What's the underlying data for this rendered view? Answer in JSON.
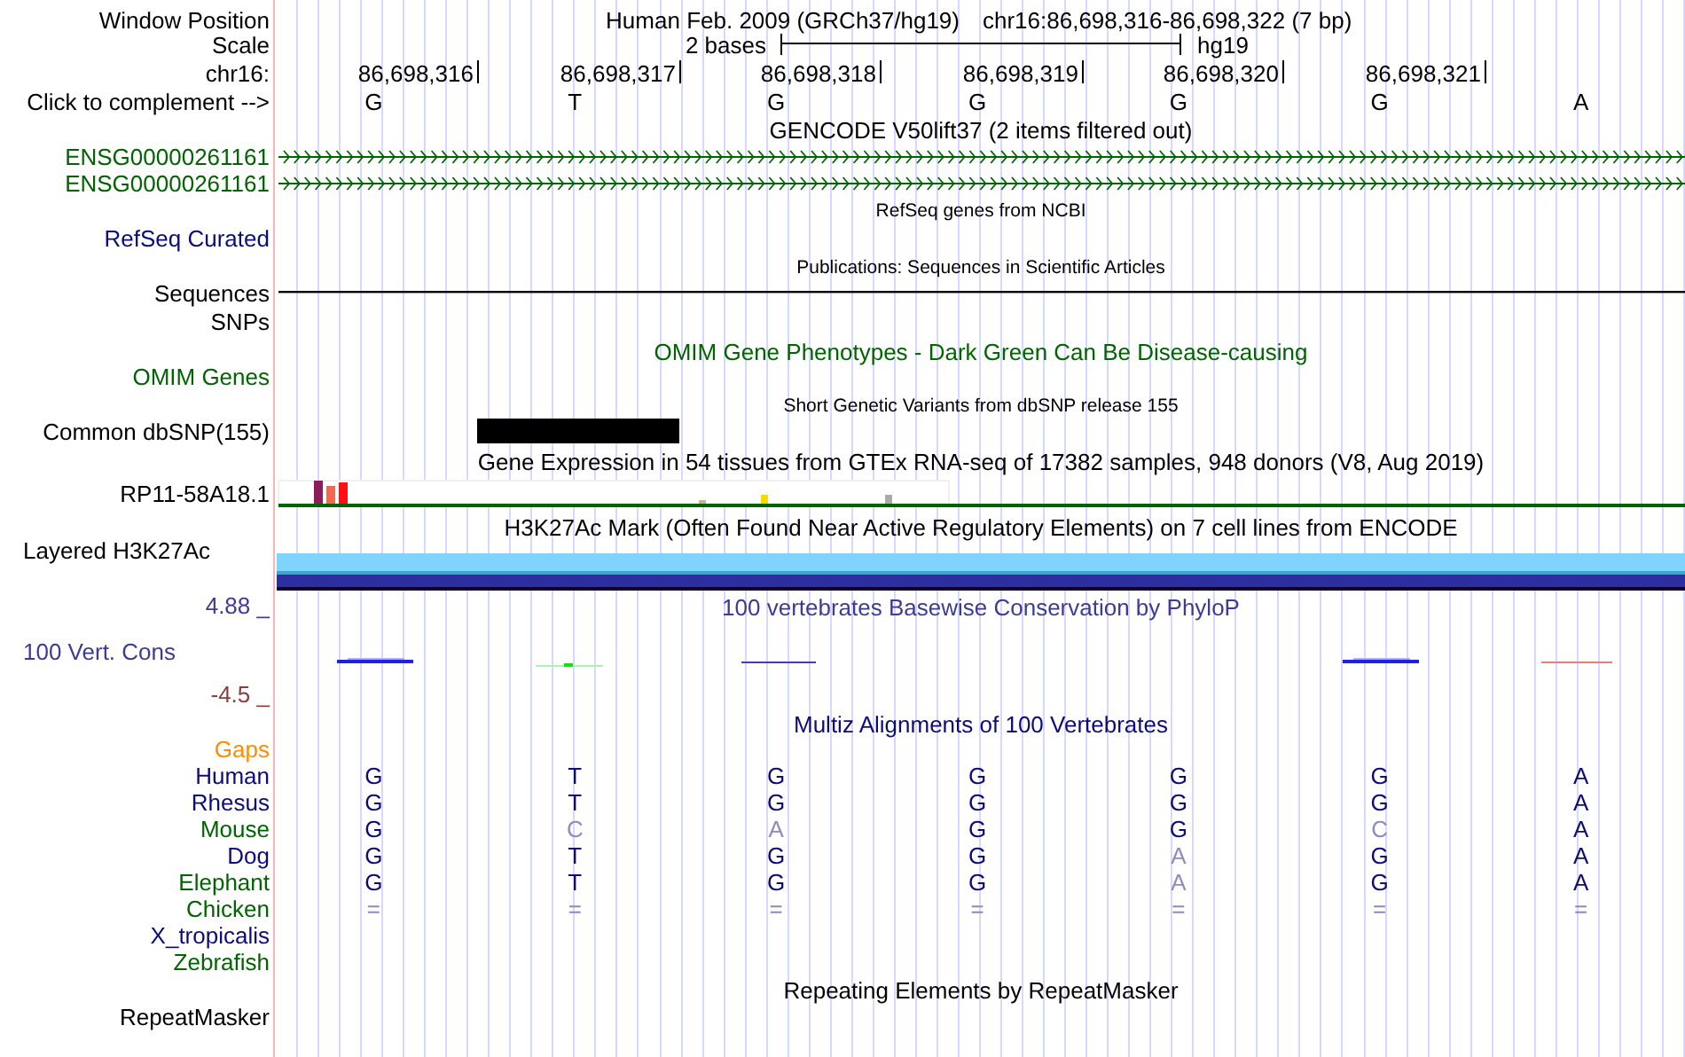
{
  "header": {
    "assembly": "Human Feb. 2009 (GRCh37/hg19)",
    "position": "chr16:86,698,316-86,698,322 (7 bp)",
    "scale_label": "2 bases",
    "scale_db": "hg19"
  },
  "ruler": {
    "positions": [
      "86,698,316",
      "86,698,317",
      "86,698,318",
      "86,698,319",
      "86,698,320",
      "86,698,321"
    ],
    "bases": [
      "G",
      "T",
      "G",
      "G",
      "G",
      "G",
      "A"
    ]
  },
  "labels": [
    {
      "text": "Window Position",
      "color": "#000000"
    },
    {
      "text": "Scale",
      "color": "#000000"
    },
    {
      "text": "chr16:",
      "color": "#000000"
    },
    {
      "text": "Click to complement -->",
      "color": "#000000"
    },
    {
      "text": "ENSG00000261161",
      "color": "#006400"
    },
    {
      "text": "ENSG00000261161",
      "color": "#006400"
    },
    {
      "text": "RefSeq Curated",
      "color": "#0c0c78"
    },
    {
      "text": "Sequences",
      "color": "#000000"
    },
    {
      "text": "SNPs",
      "color": "#000000"
    },
    {
      "text": "OMIM Genes",
      "color": "#006400"
    },
    {
      "text": "Common dbSNP(155)",
      "color": "#000000"
    },
    {
      "text": "RP11-58A18.1",
      "color": "#000000"
    },
    {
      "text": "Layered H3K27Ac",
      "color": "#000000"
    },
    {
      "text": "4.88 _",
      "color": "#3c3c96"
    },
    {
      "text": "100 Vert. Cons",
      "color": "#3c3c96"
    },
    {
      "text": "-4.5 _",
      "color": "#8c3c3c"
    },
    {
      "text": "Gaps",
      "color": "#ff8c00"
    },
    {
      "text": "Human",
      "color": "#0c0c78"
    },
    {
      "text": "Rhesus",
      "color": "#0c0c78"
    },
    {
      "text": "Mouse",
      "color": "#006400"
    },
    {
      "text": "Dog",
      "color": "#0c0c78"
    },
    {
      "text": "Elephant",
      "color": "#006400"
    },
    {
      "text": "Chicken",
      "color": "#006400"
    },
    {
      "text": "X_tropicalis",
      "color": "#0c0c78"
    },
    {
      "text": "Zebrafish",
      "color": "#006400"
    },
    {
      "text": "RepeatMasker",
      "color": "#000000"
    }
  ],
  "track_titles": [
    {
      "text": "GENCODE V50lift37 (2 items filtered out)",
      "kind": "title",
      "color": "#000000"
    },
    {
      "text": "RefSeq genes from NCBI",
      "kind": "note",
      "color": "#000000"
    },
    {
      "text": "Publications: Sequences in Scientific Articles",
      "kind": "note",
      "color": "#000000"
    },
    {
      "text": "OMIM Gene Phenotypes - Dark Green Can Be Disease-causing",
      "kind": "title",
      "color": "#006400"
    },
    {
      "text": "Short Genetic Variants from dbSNP release 155",
      "kind": "note",
      "color": "#000000"
    },
    {
      "text": "Gene Expression in 54 tissues from GTEx RNA-seq of 17382 samples, 948 donors (V8, Aug 2019)",
      "kind": "title",
      "color": "#000000"
    },
    {
      "text": "H3K27Ac Mark (Often Found Near Active Regulatory Elements) on 7 cell lines from ENCODE",
      "kind": "title",
      "color": "#000000"
    },
    {
      "text": "100 vertebrates Basewise Conservation by PhyloP",
      "kind": "title",
      "color": "#3c3c96"
    },
    {
      "text": "Multiz Alignments of 100 Vertebrates",
      "kind": "title",
      "color": "#0c0c78"
    },
    {
      "text": "Repeating Elements by RepeatMasker",
      "kind": "title",
      "color": "#000000"
    }
  ],
  "alignment_rows": [
    [
      {
        "base": "G",
        "dim": false
      },
      {
        "base": "T",
        "dim": false
      },
      {
        "base": "G",
        "dim": false
      },
      {
        "base": "G",
        "dim": false
      },
      {
        "base": "G",
        "dim": false
      },
      {
        "base": "G",
        "dim": false
      },
      {
        "base": "A",
        "dim": false
      }
    ],
    [
      {
        "base": "G",
        "dim": false
      },
      {
        "base": "T",
        "dim": false
      },
      {
        "base": "G",
        "dim": false
      },
      {
        "base": "G",
        "dim": false
      },
      {
        "base": "G",
        "dim": false
      },
      {
        "base": "G",
        "dim": false
      },
      {
        "base": "A",
        "dim": false
      }
    ],
    [
      {
        "base": "G",
        "dim": false
      },
      {
        "base": "C",
        "dim": true
      },
      {
        "base": "A",
        "dim": true
      },
      {
        "base": "G",
        "dim": false
      },
      {
        "base": "G",
        "dim": false
      },
      {
        "base": "C",
        "dim": true
      },
      {
        "base": "A",
        "dim": false
      }
    ],
    [
      {
        "base": "G",
        "dim": false
      },
      {
        "base": "T",
        "dim": false
      },
      {
        "base": "G",
        "dim": false
      },
      {
        "base": "G",
        "dim": false
      },
      {
        "base": "A",
        "dim": true
      },
      {
        "base": "G",
        "dim": false
      },
      {
        "base": "A",
        "dim": false
      }
    ],
    [
      {
        "base": "G",
        "dim": false
      },
      {
        "base": "T",
        "dim": false
      },
      {
        "base": "G",
        "dim": false
      },
      {
        "base": "G",
        "dim": false
      },
      {
        "base": "A",
        "dim": true
      },
      {
        "base": "G",
        "dim": false
      },
      {
        "base": "A",
        "dim": false
      }
    ],
    [
      {
        "base": "=",
        "dim": true
      },
      {
        "base": "=",
        "dim": true
      },
      {
        "base": "=",
        "dim": true
      },
      {
        "base": "=",
        "dim": true
      },
      {
        "base": "=",
        "dim": true
      },
      {
        "base": "=",
        "dim": true
      },
      {
        "base": "=",
        "dim": true
      }
    ]
  ]
}
